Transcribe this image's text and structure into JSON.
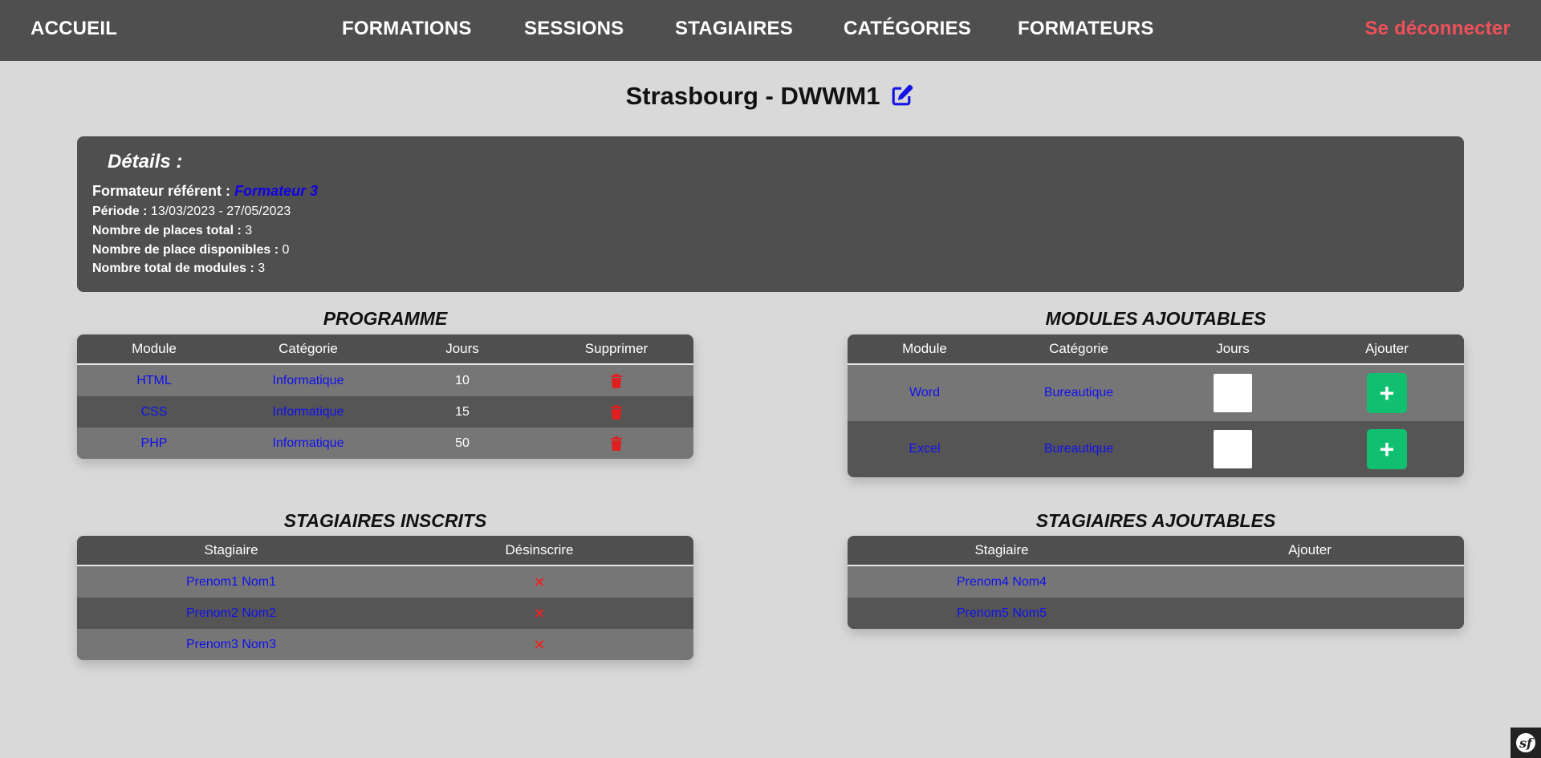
{
  "nav": {
    "home": "ACCUEIL",
    "items": [
      "FORMATIONS",
      "SESSIONS",
      "STAGIAIRES",
      "CATÉGORIES",
      "FORMATEURS"
    ],
    "logout": "Se déconnecter"
  },
  "page": {
    "title": "Strasbourg - DWWM1"
  },
  "details": {
    "heading": "Détails :",
    "ref_label": "Formateur référent :",
    "ref_value": "Formateur 3",
    "period_label": "Période :",
    "period_value": "13/03/2023 - 27/05/2023",
    "places_label": "Nombre de places total :",
    "places_value": "3",
    "available_label": "Nombre de place disponibles :",
    "available_value": "0",
    "modules_label": "Nombre total de modules :",
    "modules_value": "3"
  },
  "programme": {
    "title": "PROGRAMME",
    "headers": [
      "Module",
      "Catégorie",
      "Jours",
      "Supprimer"
    ],
    "rows": [
      {
        "module": "HTML",
        "category": "Informatique",
        "days": "10"
      },
      {
        "module": "CSS",
        "category": "Informatique",
        "days": "15"
      },
      {
        "module": "PHP",
        "category": "Informatique",
        "days": "50"
      }
    ]
  },
  "modules_add": {
    "title": "MODULES AJOUTABLES",
    "headers": [
      "Module",
      "Catégorie",
      "Jours",
      "Ajouter"
    ],
    "add_symbol": "+",
    "rows": [
      {
        "module": "Word",
        "category": "Bureautique"
      },
      {
        "module": "Excel",
        "category": "Bureautique"
      }
    ]
  },
  "inscrits": {
    "title": "STAGIAIRES INSCRITS",
    "headers": [
      "Stagiaire",
      "Désinscrire"
    ],
    "remove_symbol": "✕",
    "rows": [
      "Prenom1 Nom1",
      "Prenom2 Nom2",
      "Prenom3 Nom3"
    ]
  },
  "ajoutables": {
    "title": "STAGIAIRES AJOUTABLES",
    "headers": [
      "Stagiaire",
      "Ajouter"
    ],
    "rows": [
      "Prenom4 Nom4",
      "Prenom5 Nom5"
    ]
  },
  "colors": {
    "nav_bg": "#4f4f4f",
    "logout": "#f0505a",
    "link": "#1010ee",
    "add_green": "#10bf6f",
    "delete_red": "#e02020"
  }
}
